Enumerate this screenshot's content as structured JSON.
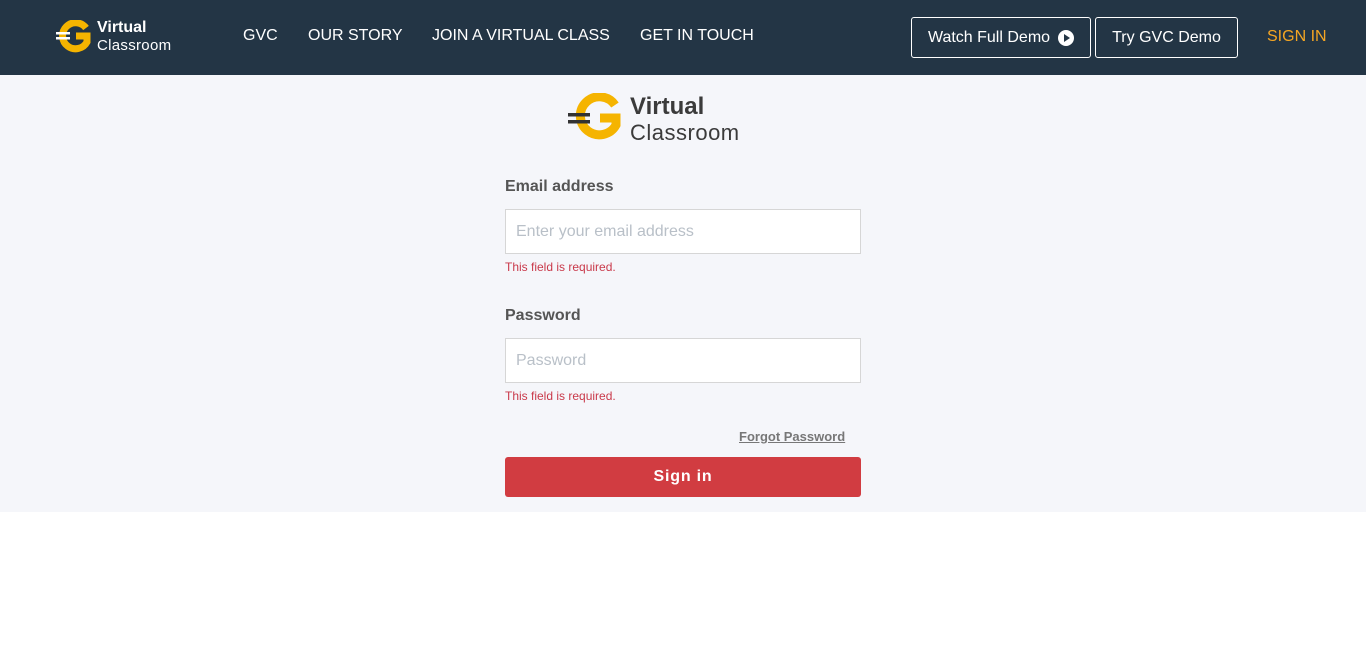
{
  "nav": {
    "logo": {
      "line1": "Virtual",
      "line2": "Classroom",
      "icon": "gvc-logo-icon"
    },
    "links": [
      "GVC",
      "OUR STORY",
      "JOIN A VIRTUAL CLASS",
      "GET IN TOUCH"
    ],
    "watch_demo_label": "Watch Full Demo",
    "watch_demo_icon": "play-circle-icon",
    "try_demo_label": "Try GVC Demo",
    "sign_in_label": "SIGN IN"
  },
  "form": {
    "logo": {
      "line1": "Virtual",
      "line2": "Classroom"
    },
    "email": {
      "label": "Email address",
      "placeholder": "Enter your email address",
      "value": "",
      "error": "This field is required."
    },
    "password": {
      "label": "Password",
      "placeholder": "Password",
      "value": "",
      "error": "This field is required."
    },
    "forgot_label": "Forgot Password",
    "submit_label": "Sign in"
  },
  "colors": {
    "nav_bg": "#233545",
    "accent_yellow": "#f5a623",
    "content_bg": "#f5f6fa",
    "button_red": "#d13c41",
    "error_red": "#c9394a"
  }
}
